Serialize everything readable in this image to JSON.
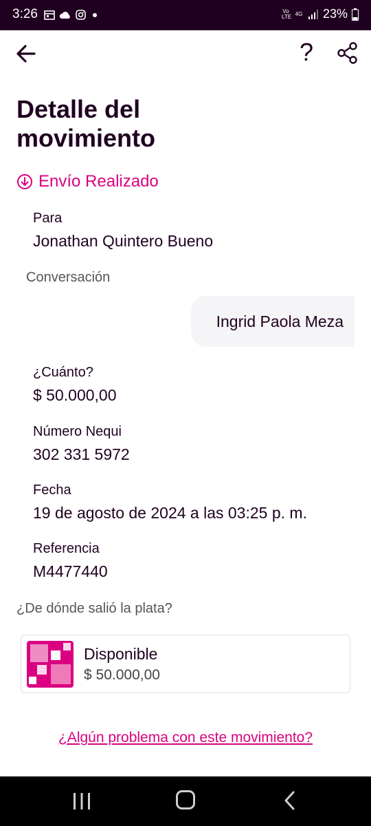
{
  "status_bar": {
    "time": "3:26",
    "network_top": "Vo LTE",
    "network_mid": "4G",
    "battery": "23%"
  },
  "header": {
    "help_label": "?",
    "title": "Detalle del movimiento"
  },
  "status": {
    "label": "Envío Realizado",
    "color": "#da0081"
  },
  "details": {
    "para_label": "Para",
    "para_value": "Jonathan Quintero Bueno",
    "conversation_label": "Conversación",
    "conversation_message": "Ingrid Paola Meza",
    "cuanto_label": "¿Cuánto?",
    "cuanto_value": "$ 50.000,00",
    "numero_label": "Número Nequi",
    "numero_value": "302 331 5972",
    "fecha_label": "Fecha",
    "fecha_value": "19 de agosto de 2024 a las 03:25 p. m.",
    "referencia_label": "Referencia",
    "referencia_value": "M4477440"
  },
  "source": {
    "label": "¿De dónde salió la plata?",
    "account_name": "Disponible",
    "account_amount": "$ 50.000,00"
  },
  "problem_link": "¿Algún problema con este movimiento?",
  "colors": {
    "brand": "#da0081",
    "dark": "#200020"
  }
}
